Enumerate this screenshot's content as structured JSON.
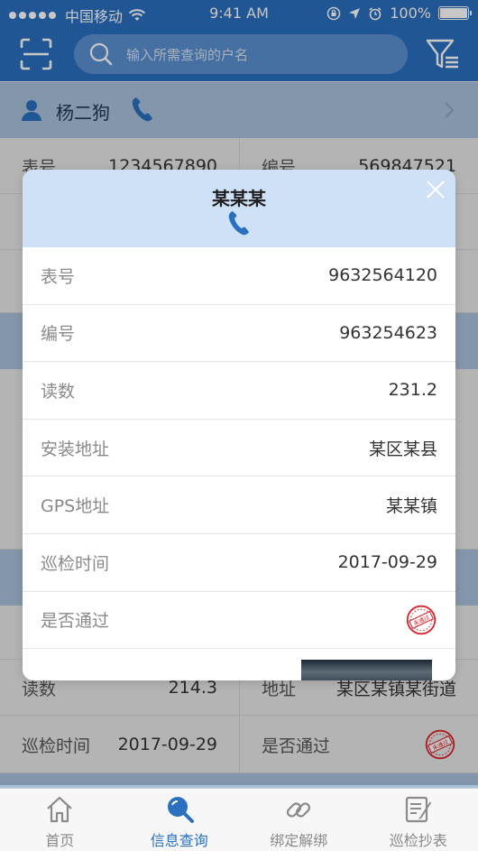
{
  "status_bar": {
    "carrier": "中国移动",
    "time": "9:41 AM",
    "battery": "100%"
  },
  "header": {
    "search_placeholder": "输入所需查询的户名",
    "icons": [
      "scan-icon",
      "search-icon",
      "filter-icon"
    ]
  },
  "background": {
    "card1": {
      "name": "杨二狗",
      "meter_label": "表号",
      "meter_value": "1234567890",
      "code_label": "编号",
      "code_value": "569847521"
    },
    "card2": {
      "reading_label": "读数",
      "reading_value": "214.3",
      "address_label": "地址",
      "address_value": "某区某镇某街道",
      "inspect_label": "巡检时间",
      "inspect_value": "2017-09-29",
      "pass_label": "是否通过"
    }
  },
  "modal": {
    "title": "某某某",
    "rows": [
      {
        "label": "表号",
        "value": "9632564120"
      },
      {
        "label": "编号",
        "value": "963254623"
      },
      {
        "label": "读数",
        "value": "231.2"
      },
      {
        "label": "安装地址",
        "value": "某区某县"
      },
      {
        "label": "GPS地址",
        "value": "某某镇"
      },
      {
        "label": "巡检时间",
        "value": "2017-09-29"
      },
      {
        "label": "是否通过",
        "value": ""
      }
    ],
    "stamp_text": "未通过"
  },
  "tabbar": {
    "tabs": [
      {
        "label": "首页",
        "icon": "home-icon"
      },
      {
        "label": "信息查询",
        "icon": "search-icon"
      },
      {
        "label": "绑定解绑",
        "icon": "link-icon"
      },
      {
        "label": "巡检抄表",
        "icon": "edit-icon"
      }
    ],
    "active_index": 1
  },
  "colors": {
    "primary": "#2b6fbf",
    "modal_head": "#cfe1f7",
    "card_head": "#a9c1dd",
    "stamp": "#d9252b"
  }
}
